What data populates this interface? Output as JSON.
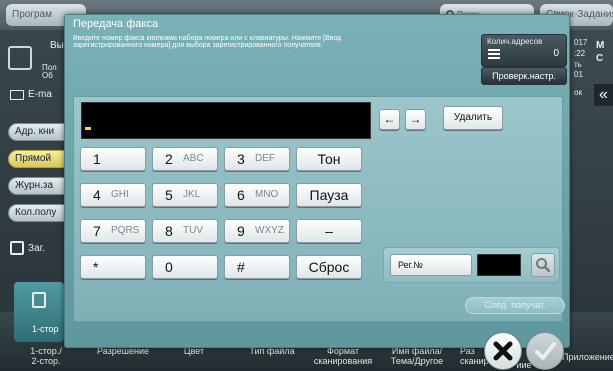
{
  "background": {
    "top_tabs": [
      "Програм",
      "",
      "Поиск",
      "Свиок-Задания"
    ],
    "left_buttons": [
      "Адр. кни",
      "Прямой",
      "Журн.за",
      "Кол.полу"
    ],
    "left_labels": {
      "email": "E-ma",
      "title_short": "Вы",
      "pol": "Пол",
      "ob": "Об",
      "zag": "Заг.",
      "one_side": "1-стор"
    },
    "right_text": [
      "017",
      "M",
      ":22",
      "C",
      "ть",
      "01"
    ],
    "right_small": "ок",
    "bottom_labels": [
      "1-стор./\n2-стор.",
      "Разрешение",
      "Цвет",
      "Тип файла",
      "Формат\nсканирования",
      "Имя файла/\nТема/Другое",
      "Раз\nсканир",
      "иие",
      "Приложение"
    ]
  },
  "dialog": {
    "title": "Передача факса",
    "instruction": "Введите номер факса кнопками набора номера или с клавиатуры. Нажмите [Ввод зарегистрированного номера] для выбора зарегистрированного получателя.",
    "address_count_label": "Колич.адресов",
    "address_count_value": "0",
    "check_settings": "Проверк.настр.",
    "delete": "Удалить",
    "arrow_left": "←",
    "arrow_right": "→",
    "keypad": [
      {
        "digit": "1",
        "letters": ""
      },
      {
        "digit": "2",
        "letters": "ABC"
      },
      {
        "digit": "3",
        "letters": "DEF"
      },
      {
        "digit": "Тон",
        "letters": ""
      },
      {
        "digit": "4",
        "letters": "GHI"
      },
      {
        "digit": "5",
        "letters": "JKL"
      },
      {
        "digit": "6",
        "letters": "MNO"
      },
      {
        "digit": "Пауза",
        "letters": ""
      },
      {
        "digit": "7",
        "letters": "PQRS"
      },
      {
        "digit": "8",
        "letters": "TUV"
      },
      {
        "digit": "9",
        "letters": "WXYZ"
      },
      {
        "digit": "–",
        "letters": ""
      },
      {
        "digit": "*",
        "letters": ""
      },
      {
        "digit": "0",
        "letters": ""
      },
      {
        "digit": "#",
        "letters": ""
      },
      {
        "digit": "Сброс",
        "letters": ""
      }
    ],
    "reg_number_label": "Рег.№",
    "next_recipient": "След. получат."
  },
  "icons": {
    "close": "close-icon",
    "ok": "check-icon",
    "search": "search-icon",
    "list": "list-icon",
    "collapse": "double-chevron-left-icon"
  },
  "colors": {
    "dialog_bg": "#6fa8ae",
    "keypad_bg": "#90bcc1",
    "display_bg": "#000000",
    "cursor": "#f5d93a",
    "active_mode": "#e8dc7c"
  }
}
